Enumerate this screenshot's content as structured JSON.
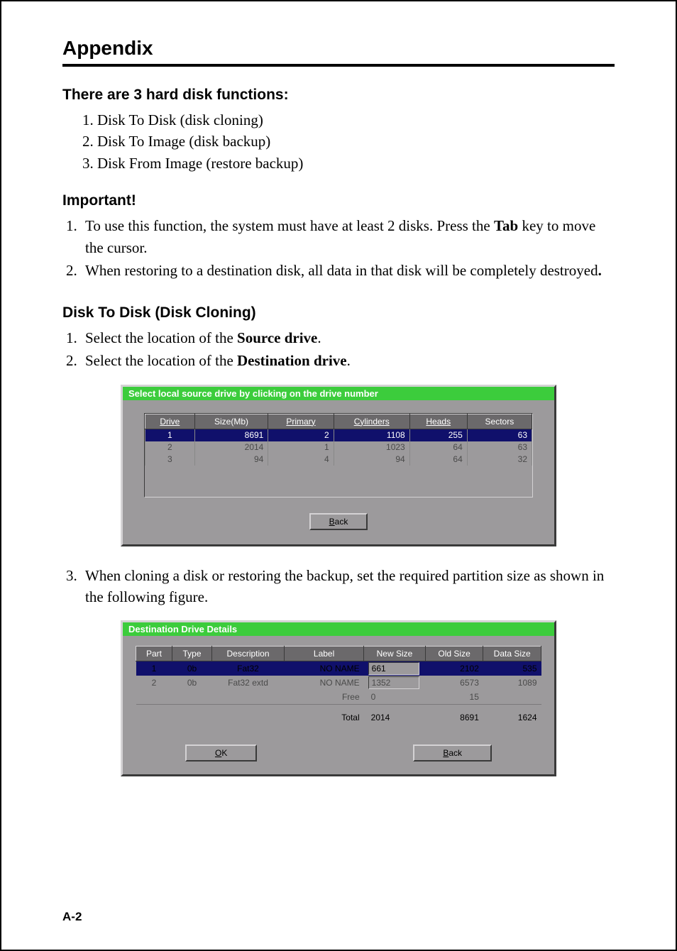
{
  "header": {
    "title": "Appendix"
  },
  "intro": {
    "heading": "There are 3 hard disk functions:",
    "items": [
      "1. Disk To Disk (disk cloning)",
      "2. Disk To Image (disk backup)",
      "3. Disk From Image (restore backup)"
    ]
  },
  "important": {
    "heading": "Important!",
    "items": [
      {
        "pre": "To use this function, the system must have at least 2 disks.  Press the ",
        "bold": "Tab",
        "post": " key to move the cursor."
      },
      {
        "pre": "When restoring to a destination disk, all data in that disk will be completely destroyed",
        "bold": ".",
        "post": ""
      }
    ]
  },
  "diskToDisk": {
    "heading": "Disk To Disk (Disk Cloning)",
    "step1": {
      "pre": "Select the location of the ",
      "bold": "Source drive",
      "post": "."
    },
    "step2": {
      "pre": "Select the location of the ",
      "bold": "Destination drive",
      "post": "."
    },
    "step3": "When cloning a disk or restoring the backup, set the required partition size as shown in the following figure."
  },
  "dialog1": {
    "title": "Select local source drive by clicking on the drive number",
    "headers": [
      "Drive",
      "Size(Mb)",
      "Primary",
      "Cylinders",
      "Heads",
      "Sectors"
    ],
    "rows": [
      {
        "drive": "1",
        "size": "8691",
        "primary": "2",
        "cylinders": "1108",
        "heads": "255",
        "sectors": "63",
        "selected": true
      },
      {
        "drive": "2",
        "size": "2014",
        "primary": "1",
        "cylinders": "1023",
        "heads": "64",
        "sectors": "63",
        "selected": false
      },
      {
        "drive": "3",
        "size": "94",
        "primary": "4",
        "cylinders": "94",
        "heads": "64",
        "sectors": "32",
        "selected": false
      }
    ],
    "back_u": "B",
    "back_rest": "ack"
  },
  "dialog2": {
    "title": "Destination Drive Details",
    "headers": [
      "Part",
      "Type",
      "Description",
      "Label",
      "New Size",
      "Old Size",
      "Data Size"
    ],
    "rows": [
      {
        "part": "1",
        "type": "0b",
        "desc": "Fat32",
        "label": "NO NAME",
        "new": "661",
        "old": "2102",
        "data": "535",
        "selected": true
      },
      {
        "part": "2",
        "type": "0b",
        "desc": "Fat32 extd",
        "label": "NO NAME",
        "new": "1352",
        "old": "6573",
        "data": "1089",
        "selected": false
      }
    ],
    "freeRow": {
      "label": "Free",
      "new": "0",
      "old": "15",
      "data": ""
    },
    "totalRow": {
      "label": "Total",
      "new": "2014",
      "old": "8691",
      "data": "1624"
    },
    "ok_u": "O",
    "ok_rest": "K",
    "back_u": "B",
    "back_rest": "ack"
  },
  "pageNumber": "A-2"
}
